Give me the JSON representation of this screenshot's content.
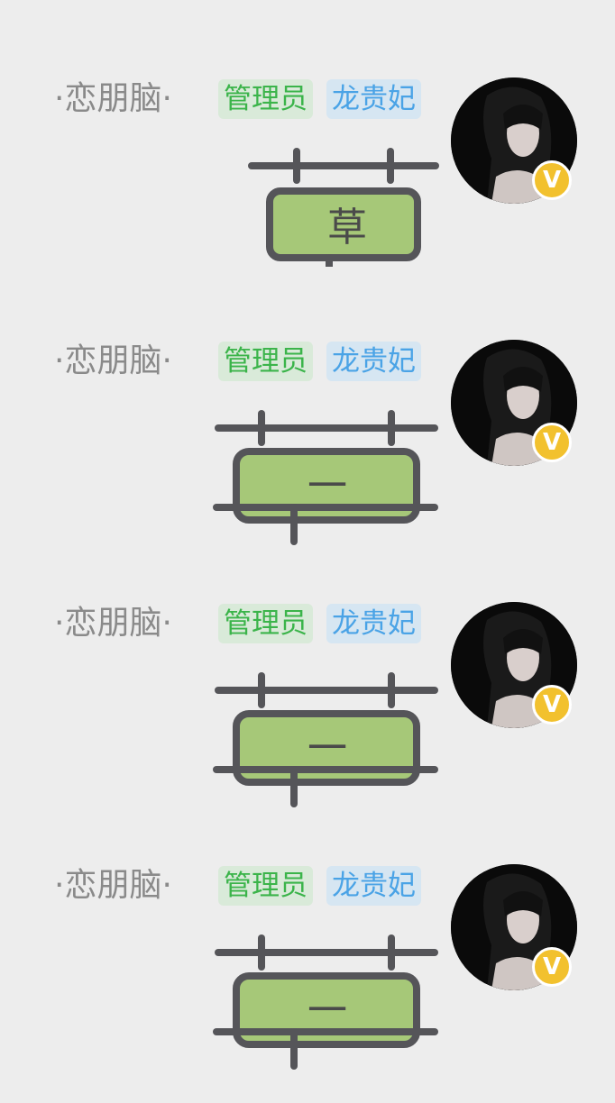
{
  "messages": [
    {
      "sender": "·恋朋脑·",
      "role_badge": "管理员",
      "title_badge": "龙贵妃",
      "vip_badge": "V",
      "sticker": {
        "text": "草"
      }
    },
    {
      "sender": "·恋朋脑·",
      "role_badge": "管理员",
      "title_badge": "龙贵妃",
      "vip_badge": "V",
      "sticker": {
        "text": "一"
      }
    },
    {
      "sender": "·恋朋脑·",
      "role_badge": "管理员",
      "title_badge": "龙贵妃",
      "vip_badge": "V",
      "sticker": {
        "text": "一"
      }
    },
    {
      "sender": "·恋朋脑·",
      "role_badge": "管理员",
      "title_badge": "龙贵妃",
      "vip_badge": "V",
      "sticker": {
        "text": "一"
      }
    }
  ],
  "colors": {
    "background": "#ededed",
    "sticker_fill": "#a6c878",
    "sticker_stroke": "#555559",
    "role_badge_bg": "#d9ead9",
    "role_badge_text": "#3bb44a",
    "title_badge_bg": "#d6e6f2",
    "title_badge_text": "#4aa3e6",
    "vip_badge": "#f2c12e"
  },
  "icons": {
    "vip": "vip-badge-icon",
    "avatar": "user-avatar"
  }
}
